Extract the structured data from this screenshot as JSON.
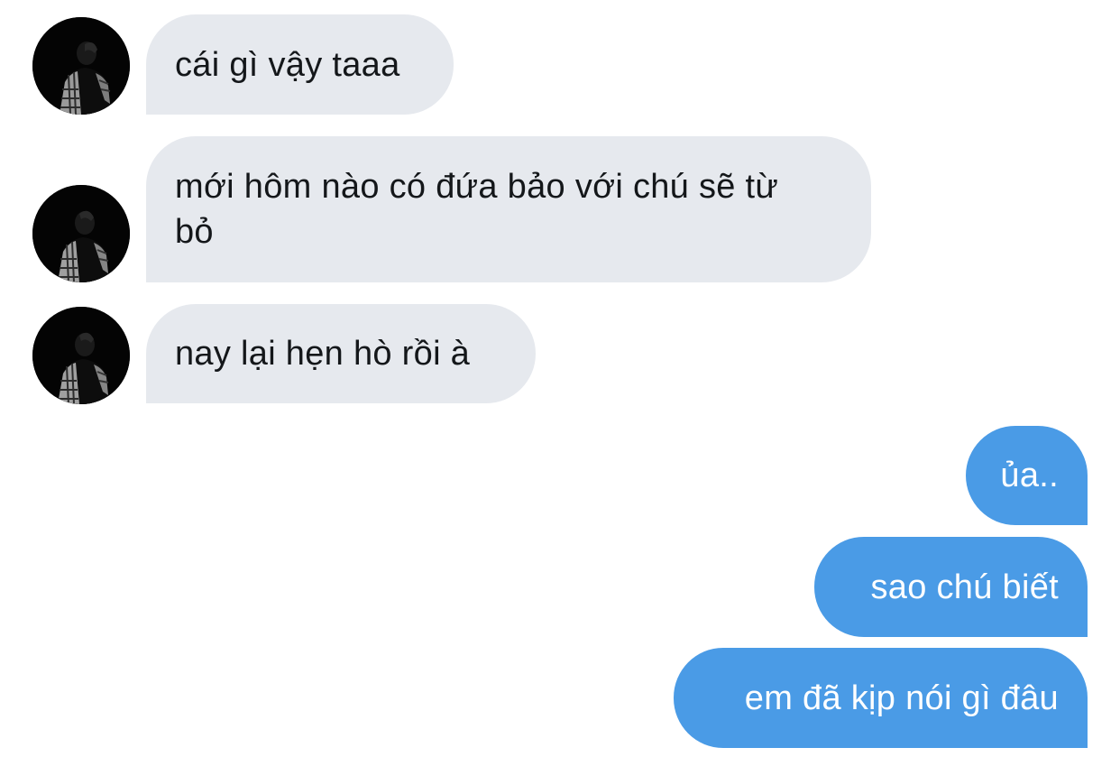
{
  "conversation": {
    "incoming": [
      {
        "text": "cái gì vậy taaa"
      },
      {
        "text": "mới hôm nào có đứa bảo với chú sẽ từ bỏ"
      },
      {
        "text": "nay lại hẹn hò rồi à"
      }
    ],
    "outgoing": [
      {
        "text": "ủa.."
      },
      {
        "text": "sao chú biết"
      },
      {
        "text": "em đã kịp nói gì đâu"
      }
    ]
  },
  "colors": {
    "incoming_bubble": "#e6e9ee",
    "incoming_text": "#14171a",
    "outgoing_bubble": "#4a9be6",
    "outgoing_text": "#ffffff",
    "background": "#ffffff"
  },
  "icons": {
    "avatar": "contact-avatar-photo"
  }
}
